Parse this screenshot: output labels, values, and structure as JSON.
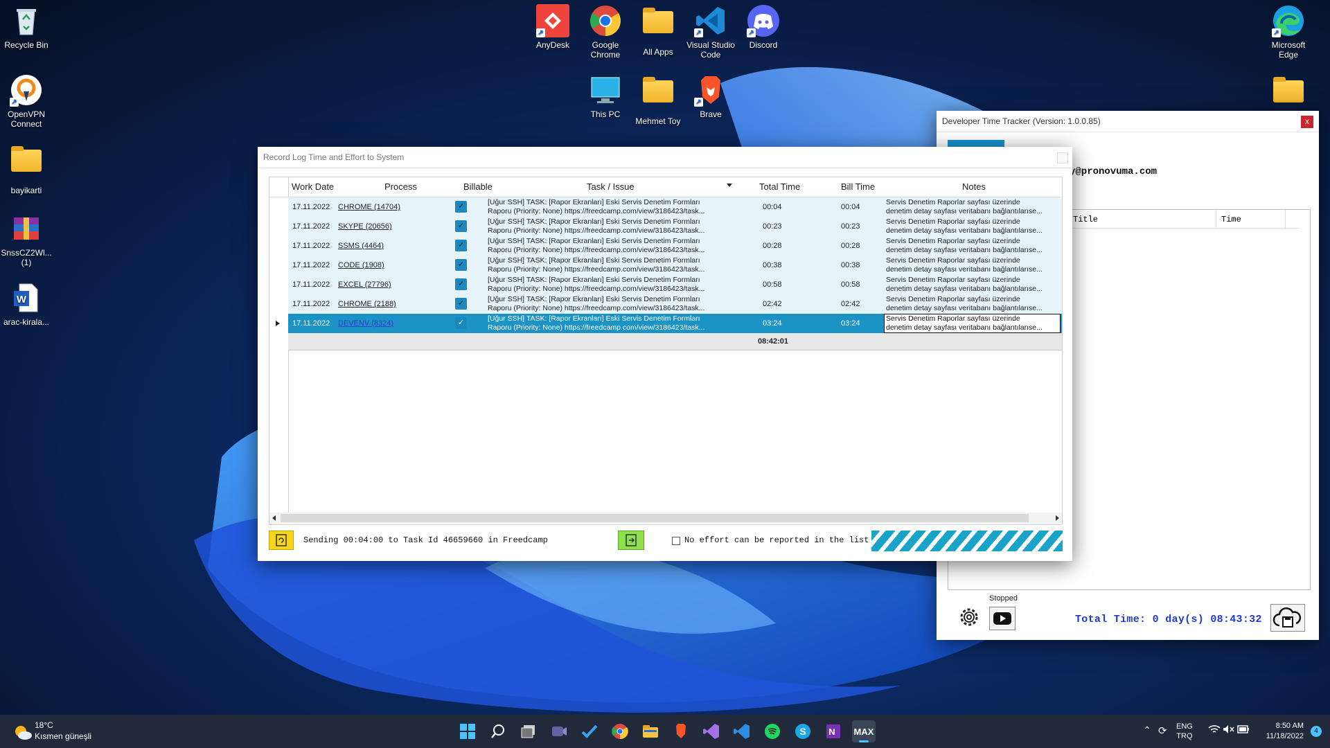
{
  "desktop": {
    "left_icons": [
      {
        "label": "Recycle Bin",
        "icon": "recycle-bin-icon"
      },
      {
        "label": "OpenVPN Connect",
        "icon": "openvpn-icon"
      },
      {
        "label": "bayikarti",
        "icon": "folder-icon"
      },
      {
        "label": "SnssCZ2Wl... (1)",
        "icon": "winrar-icon"
      },
      {
        "label": "arac-kirala...",
        "icon": "word-document-icon"
      }
    ],
    "top_icons": [
      {
        "label": "AnyDesk",
        "icon": "anydesk-icon"
      },
      {
        "label": "Google Chrome",
        "icon": "chrome-icon"
      },
      {
        "label": "All Apps",
        "icon": "folder-icon"
      },
      {
        "label": "Visual Studio Code",
        "icon": "vscode-icon"
      },
      {
        "label": "Discord",
        "icon": "discord-icon"
      },
      {
        "label": "This PC",
        "icon": "monitor-icon"
      },
      {
        "label": "Mehmet Toy",
        "icon": "folder-icon"
      },
      {
        "label": "Brave",
        "icon": "brave-icon"
      }
    ],
    "right_icons": [
      {
        "label": "Microsoft Edge",
        "icon": "edge-icon"
      }
    ]
  },
  "tracker": {
    "title": "Developer Time Tracker (Version: 1.0.0.85)",
    "close": "x",
    "email": "y@pronovuma.com",
    "col_title": "Title",
    "col_time": "Time",
    "status": "Stopped",
    "total_time": "Total Time: 0 day(s) 08:43:32"
  },
  "record": {
    "title": "Record Log Time and Effort to System",
    "columns": {
      "work_date": "Work Date",
      "process": "Process",
      "billable": "Billable",
      "task": "Task / Issue",
      "total": "Total Time",
      "bill": "Bill Time",
      "notes": "Notes"
    },
    "rows": [
      {
        "date": "17.11.2022",
        "process": "CHROME (14704)",
        "billable": true,
        "task1": "[Uğur SSH] TASK: [Rapor Ekranları] Eski Servis Denetim Formları",
        "task2": "Raporu (Priority: None) https://freedcamp.com/view/3186423/task...",
        "total": "00:04",
        "bill": "00:04",
        "note1": "Servis Denetim Raporlar sayfası üzerinde",
        "note2": "denetim detay sayfası veritabanı bağlantılarıse..."
      },
      {
        "date": "17.11.2022",
        "process": "SKYPE (20656)",
        "billable": true,
        "task1": "[Uğur SSH] TASK: [Rapor Ekranları] Eski Servis Denetim Formları",
        "task2": "Raporu (Priority: None) https://freedcamp.com/view/3186423/task...",
        "total": "00:23",
        "bill": "00:23",
        "note1": "Servis Denetim Raporlar sayfası üzerinde",
        "note2": "denetim detay sayfası veritabanı bağlantılarıse..."
      },
      {
        "date": "17.11.2022",
        "process": "SSMS (4464)",
        "billable": true,
        "task1": "[Uğur SSH] TASK: [Rapor Ekranları] Eski Servis Denetim Formları",
        "task2": "Raporu (Priority: None) https://freedcamp.com/view/3186423/task...",
        "total": "00:28",
        "bill": "00:28",
        "note1": "Servis Denetim Raporlar sayfası üzerinde",
        "note2": "denetim detay sayfası veritabanı bağlantılarıse..."
      },
      {
        "date": "17.11.2022",
        "process": "CODE (1908)",
        "billable": true,
        "task1": "[Uğur SSH] TASK: [Rapor Ekranları] Eski Servis Denetim Formları",
        "task2": "Raporu (Priority: None) https://freedcamp.com/view/3186423/task...",
        "total": "00:38",
        "bill": "00:38",
        "note1": "Servis Denetim Raporlar sayfası üzerinde",
        "note2": "denetim detay sayfası veritabanı bağlantılarıse..."
      },
      {
        "date": "17.11.2022",
        "process": "EXCEL (27796)",
        "billable": true,
        "task1": "[Uğur SSH] TASK: [Rapor Ekranları] Eski Servis Denetim Formları",
        "task2": "Raporu (Priority: None) https://freedcamp.com/view/3186423/task...",
        "total": "00:58",
        "bill": "00:58",
        "note1": "Servis Denetim Raporlar sayfası üzerinde",
        "note2": "denetim detay sayfası veritabanı bağlantılarıse..."
      },
      {
        "date": "17.11.2022",
        "process": "CHROME (2188)",
        "billable": true,
        "task1": "[Uğur SSH] TASK: [Rapor Ekranları] Eski Servis Denetim Formları",
        "task2": "Raporu (Priority: None) https://freedcamp.com/view/3186423/task...",
        "total": "02:42",
        "bill": "02:42",
        "note1": "Servis Denetim Raporlar sayfası üzerinde",
        "note2": "denetim detay sayfası veritabanı bağlantılarıse..."
      },
      {
        "date": "17.11.2022",
        "process": "DEVENV (8324)",
        "billable": true,
        "selected": true,
        "task1": "[Uğur SSH] TASK: [Rapor Ekranları] Eski Servis Denetim Formları",
        "task2": "Raporu (Priority: None) https://freedcamp.com/view/3186423/task...",
        "total": "03:24",
        "bill": "03:24",
        "note1": "Servis Denetim Raporlar sayfası üzerinde",
        "note2": "denetim detay sayfası veritabanı bağlantılarıse..."
      }
    ],
    "sum_total": "08:42:01",
    "status_text": "Sending 00:04:00 to Task Id 46659660 in Freedcamp",
    "no_effort_label": "No effort can be reported in the list"
  },
  "taskbar": {
    "weather_temp": "18°C",
    "weather_text": "Kısmen güneşli",
    "apps": [
      "start-icon",
      "search-icon",
      "task-view-icon",
      "teams-icon",
      "todo-icon",
      "chrome-icon",
      "file-explorer-icon",
      "brave-icon",
      "visual-studio-icon",
      "vscode-icon",
      "spotify-icon",
      "skype-icon",
      "onenote-icon",
      "time-tracker-icon"
    ],
    "lang1": "ENG",
    "lang2": "TRQ",
    "time": "8:50 AM",
    "date": "11/18/2022",
    "notifications": "4"
  }
}
